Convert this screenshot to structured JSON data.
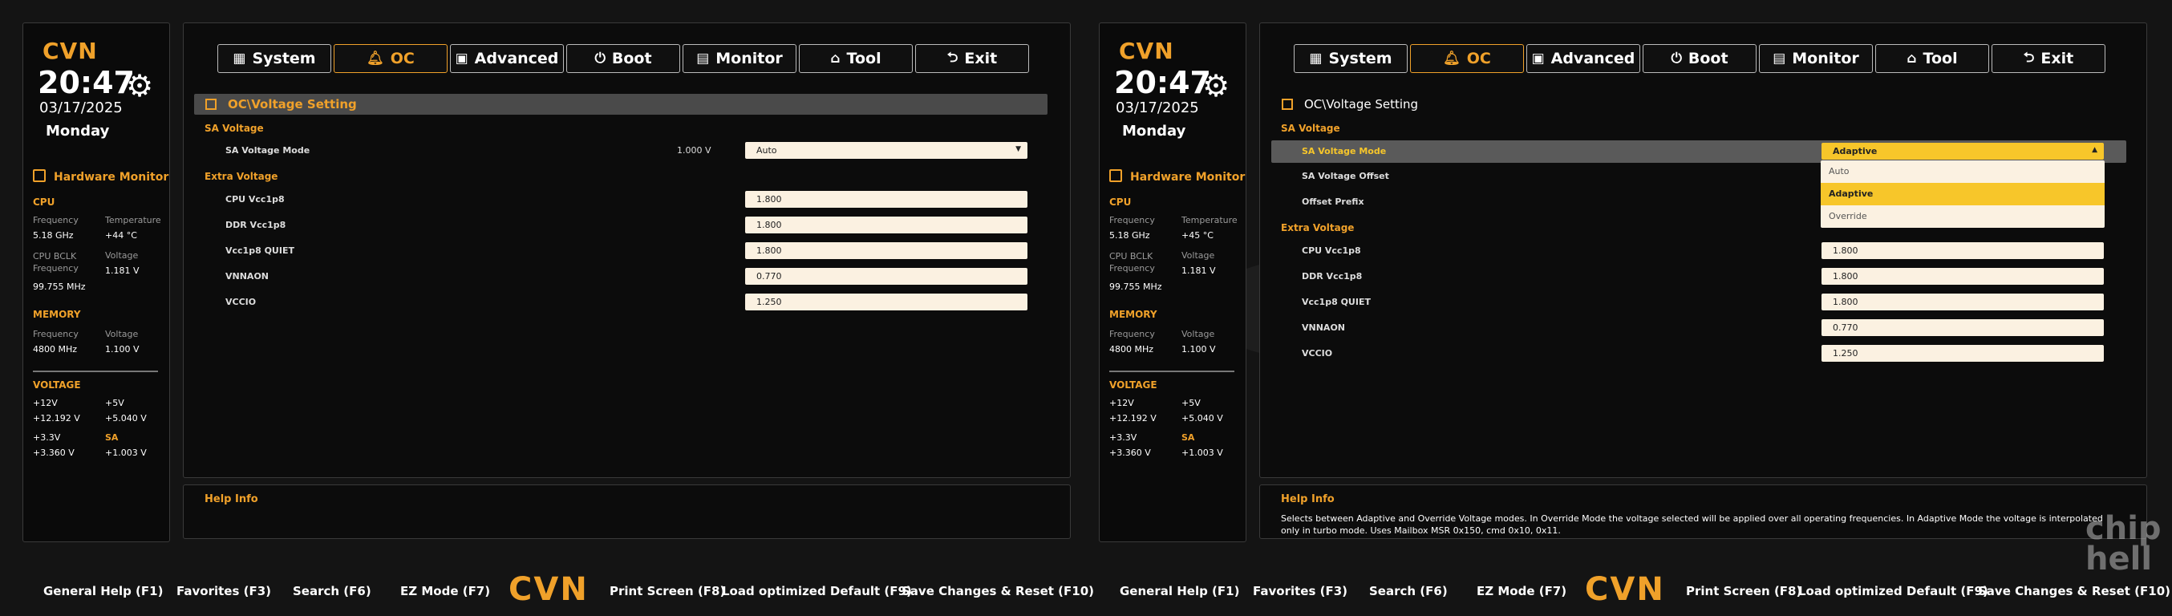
{
  "brand": "CVN",
  "clock": {
    "time": "20:47",
    "date": "03/17/2025",
    "day": "Monday"
  },
  "tabs": [
    {
      "label": "System",
      "icon": "grid-icon"
    },
    {
      "label": "OC",
      "icon": "bell-icon"
    },
    {
      "label": "Advanced",
      "icon": "chip-icon"
    },
    {
      "label": "Boot",
      "icon": "power-icon"
    },
    {
      "label": "Monitor",
      "icon": "monitor-icon"
    },
    {
      "label": "Tool",
      "icon": "toolbox-icon"
    },
    {
      "label": "Exit",
      "icon": "exit-arrow-icon"
    }
  ],
  "hw": {
    "title": "Hardware Monitor",
    "cpu_title": "CPU",
    "freq_label": "Frequency",
    "temp_label": "Temperature",
    "bclk_label": "CPU BCLK Frequency",
    "volt_label": "Voltage",
    "memory_title": "MEMORY",
    "voltage_title": "VOLTAGE",
    "cpu_bclk": "99.755 MHz",
    "cpu_voltage": "1.181 V",
    "mem_freq": "4800 MHz",
    "mem_voltage": "1.100 V",
    "v12_label": "+12V",
    "v12": "+12.192 V",
    "v5_label": "+5V",
    "v5": "+5.040 V",
    "v33_label": "+3.3V",
    "v33": "+3.360 V",
    "sa_label": "SA",
    "sa": "+1.003 V"
  },
  "panels": [
    {
      "cpu_freq": "5.18 GHz",
      "cpu_temp": "+44 °C"
    },
    {
      "cpu_freq": "5.18 GHz",
      "cpu_temp": "+45 °C"
    }
  ],
  "path": "OC\\Voltage Setting",
  "sa_voltage_group": "SA Voltage",
  "extra_voltage_group": "Extra Voltage",
  "sa_voltage_mode_label": "SA Voltage Mode",
  "sa_voltage_mode_reading": "1.000 V",
  "left_mode_value": "Auto",
  "right_mode_value": "Adaptive",
  "sa_voltage_offset_label": "SA Voltage Offset",
  "offset_prefix_label": "Offset Prefix",
  "dropdown_options": [
    "Auto",
    "Adaptive",
    "Override"
  ],
  "extra_rows": [
    {
      "label": "CPU Vcc1p8",
      "value": "1.800"
    },
    {
      "label": "DDR Vcc1p8",
      "value": "1.800"
    },
    {
      "label": "Vcc1p8 QUIET",
      "value": "1.800"
    },
    {
      "label": "VNNAON",
      "value": "0.770"
    },
    {
      "label": "VCCIO",
      "value": "1.250"
    }
  ],
  "help": {
    "title": "Help Info",
    "text_right": "Selects between Adaptive and Override Voltage modes. In Override Mode the voltage selected will be applied over all operating frequencies. In Adaptive Mode the voltage is interpolated only in turbo mode. Uses Mailbox MSR 0x150, cmd 0x10, 0x11."
  },
  "footer": {
    "general_help": "General Help (F1)",
    "favorites": "Favorites (F3)",
    "search": "Search (F6)",
    "ez_mode": "EZ Mode (F7)",
    "print_screen": "Print Screen (F8)",
    "load_default": "Load optimized Default (F9)",
    "save_reset": "Save Changes & Reset (F10)"
  },
  "watermark": "chip hell",
  "colors": {
    "accent": "#f0a12a",
    "field": "#fbf1e1",
    "selected": "#f7c62a"
  }
}
